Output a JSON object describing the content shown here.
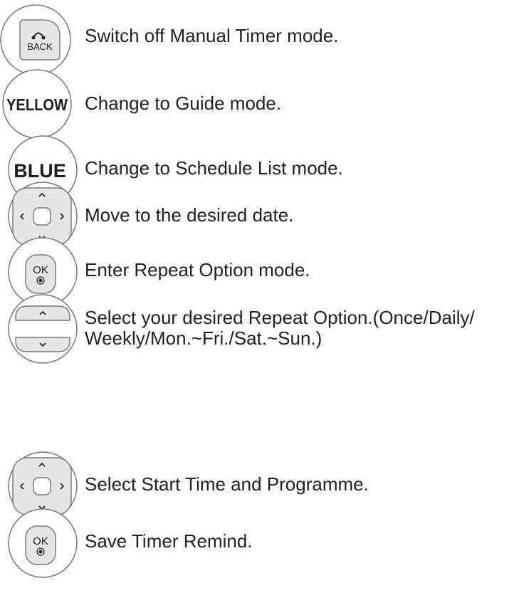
{
  "rows": [
    {
      "icon": "back-button-icon",
      "button_label": "BACK",
      "text": "Switch off Manual Timer mode."
    },
    {
      "icon": "yellow-button-icon",
      "button_label": "YELLOW",
      "text": "Change to Guide mode."
    },
    {
      "icon": "blue-button-icon",
      "button_label": "BLUE",
      "text": "Change to Schedule List mode."
    },
    {
      "icon": "navigation-pad-icon",
      "text": "Move to the desired date."
    },
    {
      "icon": "ok-button-icon",
      "button_label": "OK",
      "text": "Enter Repeat Option mode."
    },
    {
      "icon": "up-down-buttons-icon",
      "text": "Select your desired Repeat Option.(Once/Daily/\nWeekly/Mon.~Fri./Sat.~Sun.)"
    },
    {
      "icon": "navigation-pad-icon",
      "text": "Select Start Time and Programme."
    },
    {
      "icon": "ok-button-icon",
      "button_label": "OK",
      "text": "Save Timer Remind."
    }
  ],
  "colors": {
    "button_fill": "#e6e6e6",
    "outline": "#7a7a7a",
    "text": "#231f20"
  }
}
